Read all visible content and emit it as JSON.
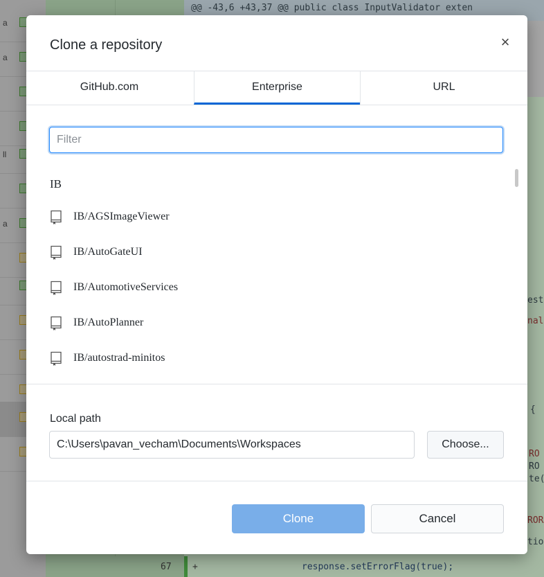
{
  "background": {
    "diff_header": "@@ -43,6 +43,37 @@ public class InputValidator exten",
    "left_list": [
      {
        "text": "a",
        "status": "added"
      },
      {
        "text": "a",
        "status": "added"
      },
      {
        "text": "",
        "status": "added"
      },
      {
        "text": "",
        "status": "added"
      },
      {
        "text": "ll",
        "status": "added"
      },
      {
        "text": "",
        "status": "added"
      },
      {
        "text": "a",
        "status": "added"
      },
      {
        "text": "",
        "status": "modified"
      },
      {
        "text": "",
        "status": "added"
      },
      {
        "text": "",
        "status": "modified"
      },
      {
        "text": "",
        "status": "modified"
      },
      {
        "text": "",
        "status": "modified"
      },
      {
        "text": "",
        "status": "modified"
      },
      {
        "text": "",
        "status": "modified"
      }
    ],
    "code_fragments": [
      "est",
      "nal",
      "{",
      "RO",
      "RO",
      "te(",
      "ROR",
      "tio"
    ],
    "bottom_line_number": "67",
    "bottom_line_marker": "+",
    "bottom_line_code": "response.setErrorFlag(true);"
  },
  "dialog": {
    "title": "Clone a repository",
    "close_icon": "×",
    "tabs": [
      {
        "label": "GitHub.com",
        "active": false
      },
      {
        "label": "Enterprise",
        "active": true
      },
      {
        "label": "URL",
        "active": false
      }
    ],
    "filter": {
      "placeholder": "Filter",
      "value": ""
    },
    "group_header": "IB",
    "repos": [
      "IB/AGSImageViewer",
      "IB/AutoGateUI",
      "IB/AutomotiveServices",
      "IB/AutoPlanner",
      "IB/autostrad-minitos"
    ],
    "local_path": {
      "label": "Local path",
      "value": "C:\\Users\\pavan_vecham\\Documents\\Workspaces",
      "choose_label": "Choose..."
    },
    "clone_label": "Clone",
    "cancel_label": "Cancel"
  },
  "colors": {
    "accent": "#0366d6",
    "clone_button": "#79aee9",
    "added": "#3e7a2f",
    "modified": "#9a7d1c"
  }
}
